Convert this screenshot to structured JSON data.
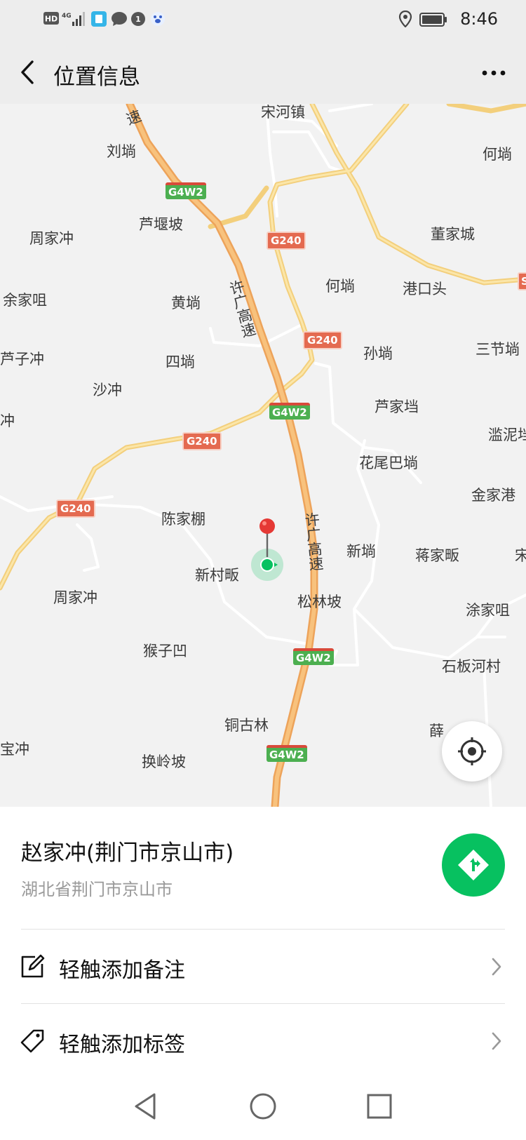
{
  "status_bar": {
    "network": "HD",
    "signal": "4G",
    "time": "8:46",
    "icons": [
      "hd-icon",
      "signal-icon",
      "app-icon",
      "message-icon",
      "notification-icon",
      "baidu-icon",
      "location-icon",
      "battery-icon"
    ]
  },
  "header": {
    "title": "位置信息",
    "back_icon": "chevron-left-icon",
    "more_icon": "more-dots-icon"
  },
  "map": {
    "places": [
      {
        "id": "songhezhen",
        "label": "宋河镇"
      },
      {
        "id": "liuwan",
        "label": "刘埫"
      },
      {
        "id": "hewan-top",
        "label": "何埫"
      },
      {
        "id": "luyanpo",
        "label": "芦堰坡"
      },
      {
        "id": "zhoujiachong-top",
        "label": "周家冲"
      },
      {
        "id": "dongjiacheng",
        "label": "董家城"
      },
      {
        "id": "hewan",
        "label": "何埫"
      },
      {
        "id": "gangkoutou",
        "label": "港口头"
      },
      {
        "id": "yujiaju",
        "label": "余家咀"
      },
      {
        "id": "huangwan",
        "label": "黄埫"
      },
      {
        "id": "sunwan",
        "label": "孙埫"
      },
      {
        "id": "sanjiewan",
        "label": "三节埫"
      },
      {
        "id": "luzichong",
        "label": "芦子冲"
      },
      {
        "id": "siwan",
        "label": "四埫"
      },
      {
        "id": "shachong",
        "label": "沙冲"
      },
      {
        "id": "lujiadang",
        "label": "芦家垱"
      },
      {
        "id": "chong-left",
        "label": "冲"
      },
      {
        "id": "lanni",
        "label": "滥泥垱"
      },
      {
        "id": "huaweibawan",
        "label": "花尾巴埫"
      },
      {
        "id": "jinjiagang",
        "label": "金家港"
      },
      {
        "id": "chenjiapeng",
        "label": "陈家棚"
      },
      {
        "id": "xinwan",
        "label": "新埫"
      },
      {
        "id": "jiangjiafan",
        "label": "蒋家畈"
      },
      {
        "id": "song-right",
        "label": "宋"
      },
      {
        "id": "xincunfan",
        "label": "新村畈"
      },
      {
        "id": "songlinpo",
        "label": "松林坡"
      },
      {
        "id": "zhoujiachong",
        "label": "周家冲"
      },
      {
        "id": "tujiaju",
        "label": "涂家咀"
      },
      {
        "id": "houziao",
        "label": "猴子凹"
      },
      {
        "id": "shibanhecun",
        "label": "石板河村"
      },
      {
        "id": "tongulin",
        "label": "铜古林"
      },
      {
        "id": "xue",
        "label": "薛"
      },
      {
        "id": "baochong",
        "label": "宝冲"
      },
      {
        "id": "huanlingpo",
        "label": "换岭坡"
      }
    ],
    "road_labels": {
      "expressway_1": "速",
      "expressway_2": "许广高速",
      "expressway_3": "许广高速"
    },
    "shields": {
      "g4w2": "G4W2",
      "g240": "G240",
      "s_right": "S"
    },
    "locate_icon": "crosshair-icon",
    "pin_icon": "map-pin-icon",
    "user_icon": "current-location-icon"
  },
  "location": {
    "name": "赵家冲(荆门市京山市)",
    "address": "湖北省荆门市京山市",
    "nav_icon": "navigation-icon"
  },
  "actions": [
    {
      "label": "轻触添加备注",
      "icon": "edit-note-icon"
    },
    {
      "label": "轻触添加标签",
      "icon": "tag-icon"
    }
  ],
  "colors": {
    "accent": "#07c160",
    "highway": "#f6b36a",
    "road": "#f7d98a",
    "pin": "#e53935"
  }
}
